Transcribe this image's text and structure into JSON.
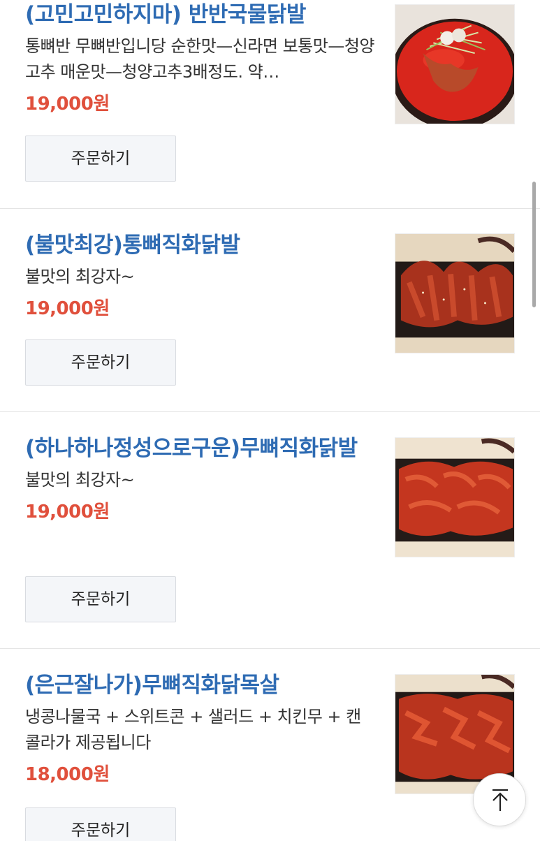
{
  "menu": {
    "order_label": "주문하기",
    "items": [
      {
        "name": "(고민고민하지마) 반반국물닭발",
        "description": "통뼈반 무뼈반입니당 순한맛—신라면 보통맛—청양고추 매운맛—청양고추3배정도. 약…",
        "price": "19,000원",
        "image_icon": "spicy-soup-chicken-feet-photo"
      },
      {
        "name": "(불맛최강)통뼈직화닭발",
        "description": "불맛의 최강자~",
        "price": "19,000원",
        "image_icon": "grilled-bone-in-chicken-feet-photo"
      },
      {
        "name": "(하나하나정성으로구운)무뼈직화닭발",
        "description": "불맛의 최강자~",
        "price": "19,000원",
        "image_icon": "grilled-boneless-chicken-feet-photo"
      },
      {
        "name": "(은근잘나가)무뼈직화닭목살",
        "description": "냉콩나물국 + 스위트콘 + 샐러드 + 치킨무 + 캔콜라가 제공됩니다",
        "price": "18,000원",
        "image_icon": "grilled-chicken-neck-photo"
      }
    ]
  },
  "colors": {
    "name": "#2e6bb3",
    "price": "#e0503c",
    "button_bg": "#f4f6f9"
  },
  "icons": {
    "scroll_top": "arrow-up-icon"
  }
}
